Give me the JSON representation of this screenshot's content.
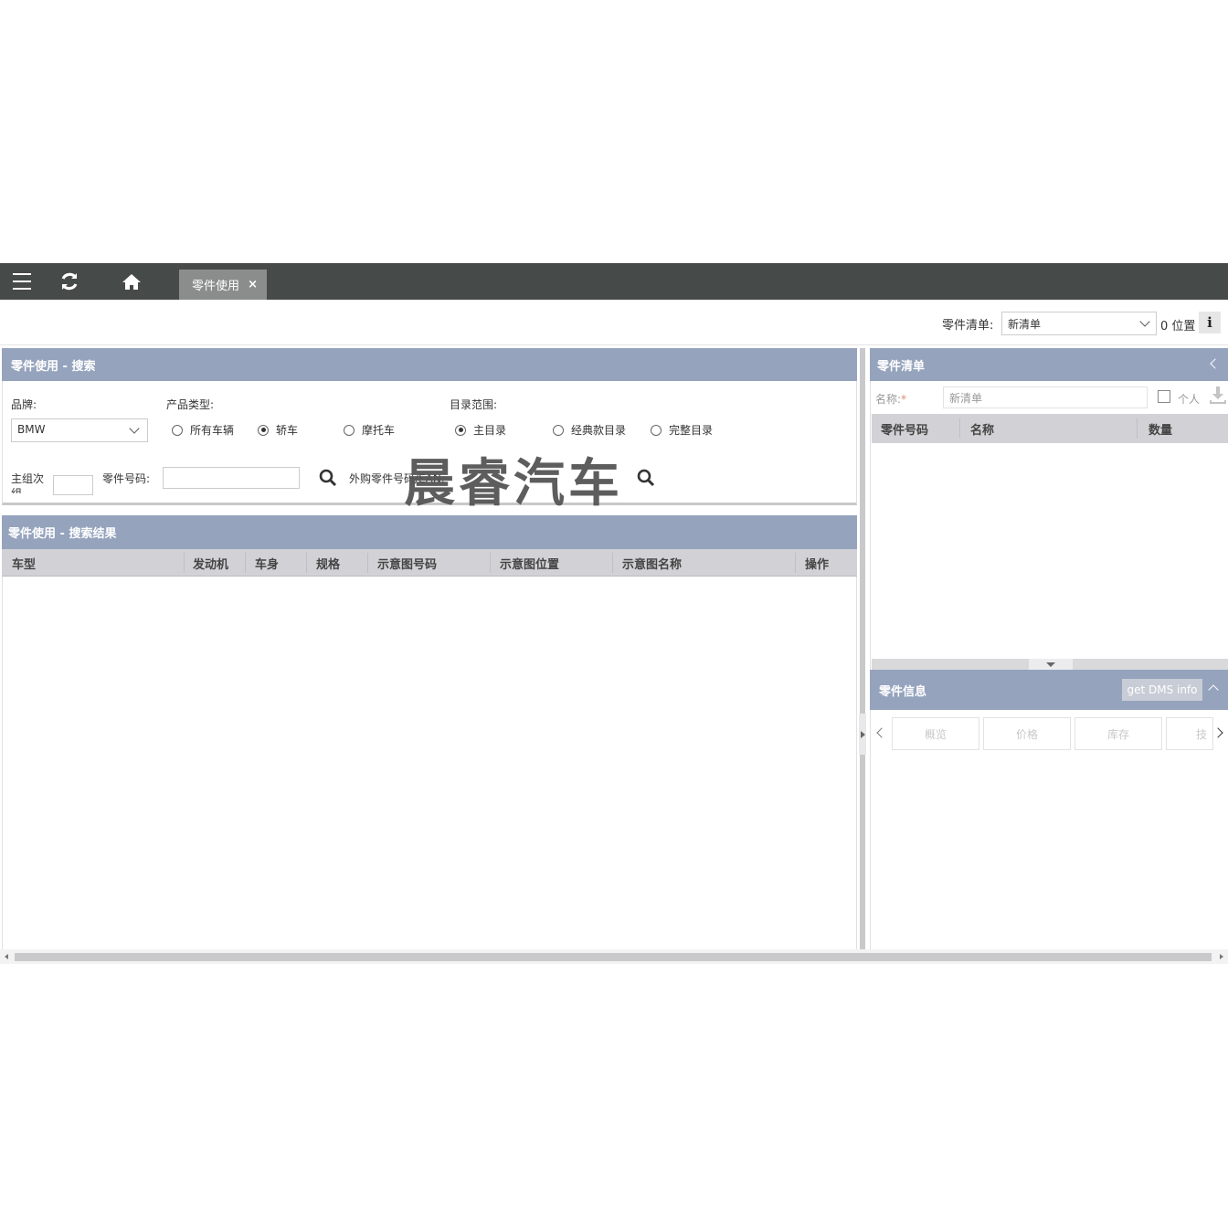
{
  "topbar": {
    "tab_label": "零件使用",
    "tab_close": "×"
  },
  "header": {
    "parts_list_label": "零件清单:",
    "parts_list_value": "新清单",
    "position_count": "0 位置",
    "info_label": "i"
  },
  "search": {
    "title": "零件使用 - 搜索",
    "brand_label": "品牌:",
    "brand_value": "BMW",
    "product_type_label": "产品类型:",
    "product_types": [
      "所有车辆",
      "轿车",
      "摩托车"
    ],
    "product_type_selected": 1,
    "catalog_scope_label": "目录范围:",
    "catalog_scopes": [
      "主目录",
      "经典款目录",
      "完整目录"
    ],
    "catalog_scope_selected": 0,
    "main_group_label": "主组次组",
    "part_number_label": "零件号码:",
    "external_part_label": "外购零件号码/EAN:"
  },
  "watermark": "晨睿汽车",
  "results": {
    "title": "零件使用 - 搜索结果",
    "columns": [
      "车型",
      "发动机",
      "车身",
      "规格",
      "示意图号码",
      "示意图位置",
      "示意图名称",
      "操作"
    ]
  },
  "parts_list": {
    "title": "零件清单",
    "name_label": "名称:",
    "name_required": "*",
    "name_placeholder": "新清单",
    "personal_label": "个人",
    "columns": [
      "零件号码",
      "名称",
      "数量"
    ]
  },
  "part_info": {
    "title": "零件信息",
    "dms_button": "get DMS info",
    "tabs": [
      "概览",
      "价格",
      "库存",
      "技"
    ]
  }
}
